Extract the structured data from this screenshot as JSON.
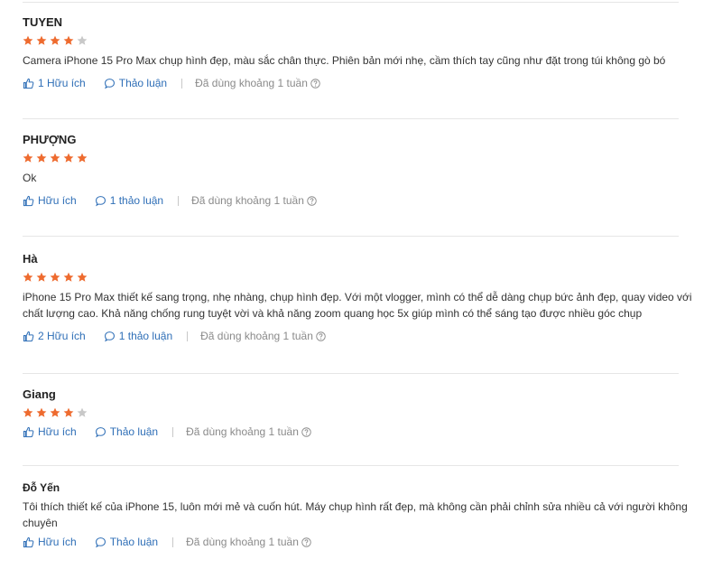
{
  "colors": {
    "star_on": "#ee6b2f",
    "star_off": "#c8c8c8",
    "link": "#2f6fb7",
    "muted": "#8a8a8a"
  },
  "icons": {
    "like": "thumbs-up-icon",
    "discuss": "speech-bubble-icon",
    "help": "question-circle-icon",
    "star": "star-icon"
  },
  "reviews": [
    {
      "name": "TUYEN",
      "rating": 4,
      "content": "Camera iPhone 15 Pro Max chụp hình đẹp, màu sắc chân thực. Phiên bản mới nhẹ, cầm thích tay cũng như đặt trong túi không gò bó",
      "helpful": "1 Hữu ích",
      "discuss": "Thảo luận",
      "used": "Đã dùng khoảng 1 tuần"
    },
    {
      "name": "PHƯỢNG",
      "rating": 5,
      "content": "Ok",
      "helpful": "Hữu ích",
      "discuss": "1 thảo luận",
      "used": "Đã dùng khoảng 1 tuần"
    },
    {
      "name": "Hà",
      "rating": 5,
      "content": "iPhone 15 Pro Max thiết kế sang trọng, nhẹ nhàng, chụp hình đẹp. Với một vlogger, mình có thể dễ dàng chụp bức ảnh đẹp, quay video với chất lượng cao. Khả năng chống rung tuyệt vời và khả năng zoom quang học 5x giúp mình có thể sáng tạo được nhiều góc chụp",
      "helpful": "2 Hữu ích",
      "discuss": "1 thảo luận",
      "used": "Đã dùng khoảng 1 tuần"
    },
    {
      "name": "Giang",
      "rating": 4,
      "content": "",
      "helpful": "Hữu ích",
      "discuss": "Thảo luận",
      "used": "Đã dùng khoảng 1 tuần"
    },
    {
      "name": "Đỗ Yến",
      "rating": null,
      "content": "Tôi thích thiết kế của iPhone 15, luôn mới mẻ và cuốn hút. Máy chụp hình rất đẹp, mà không cần phải chỉnh sửa nhiều cả với người không chuyên",
      "helpful": "Hữu ích",
      "discuss": "Thảo luận",
      "used": "Đã dùng khoảng 1 tuần"
    }
  ]
}
